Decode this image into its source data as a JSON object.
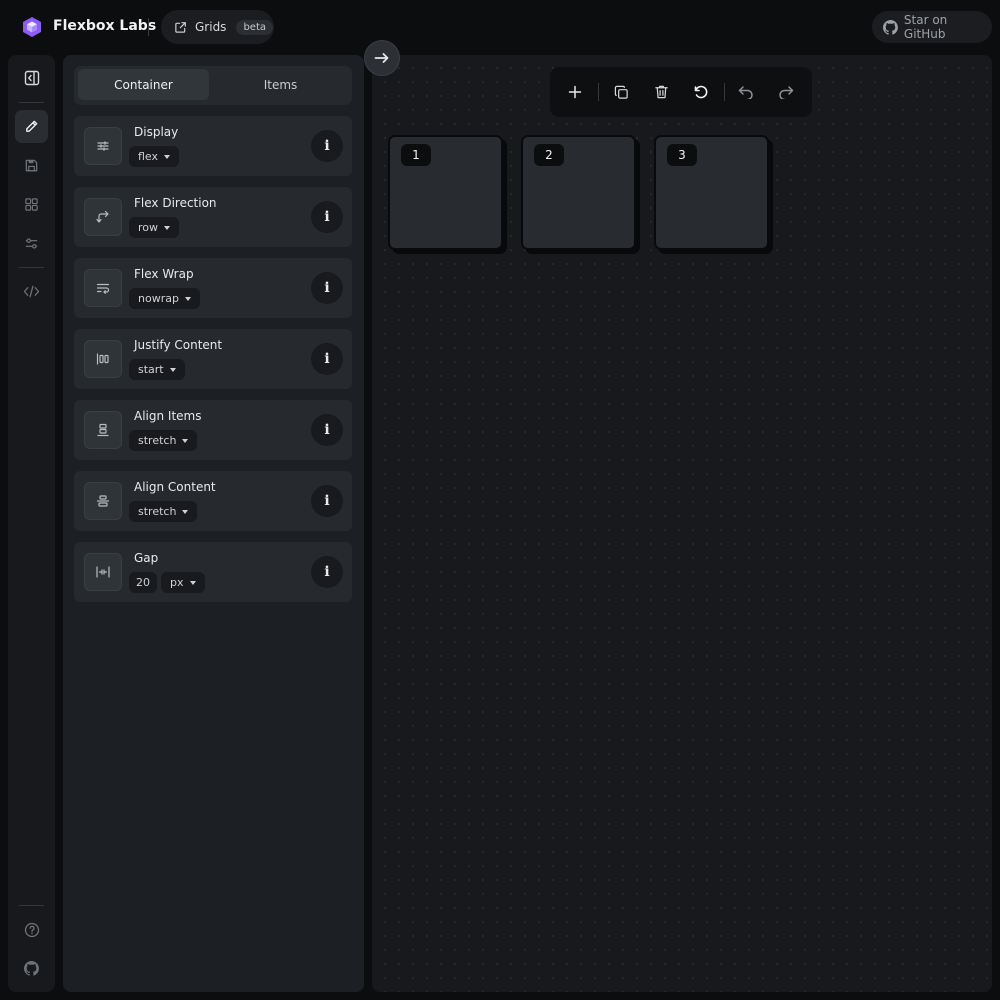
{
  "header": {
    "brand": "Flexbox Labs",
    "grids_label": "Grids",
    "beta_badge": "beta",
    "github_label": "Star on GitHub",
    "brand_color": "#8b5cf6"
  },
  "rail": {
    "items": [
      "toggle-sidebar-icon",
      "pencil-icon",
      "save-icon",
      "grid-icon",
      "sliders-icon",
      "code-icon",
      "help-icon",
      "github-icon"
    ]
  },
  "panel": {
    "tabs": [
      {
        "label": "Container",
        "active": true
      },
      {
        "label": "Items",
        "active": false
      }
    ],
    "properties": [
      {
        "title": "Display",
        "value": "flex",
        "icon": "display-icon"
      },
      {
        "title": "Flex Direction",
        "value": "row",
        "icon": "direction-icon"
      },
      {
        "title": "Flex Wrap",
        "value": "nowrap",
        "icon": "wrap-icon"
      },
      {
        "title": "Justify Content",
        "value": "start",
        "icon": "justify-icon"
      },
      {
        "title": "Align Items",
        "value": "stretch",
        "icon": "align-items-icon"
      },
      {
        "title": "Align Content",
        "value": "stretch",
        "icon": "align-content-icon"
      },
      {
        "title": "Gap",
        "value": "20",
        "unit": "px",
        "icon": "gap-icon"
      }
    ],
    "info_glyph": "i"
  },
  "canvas": {
    "toolbar": [
      "add-icon",
      "duplicate-icon",
      "delete-icon",
      "reset-icon",
      "undo-icon",
      "redo-icon"
    ],
    "items": [
      "1",
      "2",
      "3"
    ]
  }
}
